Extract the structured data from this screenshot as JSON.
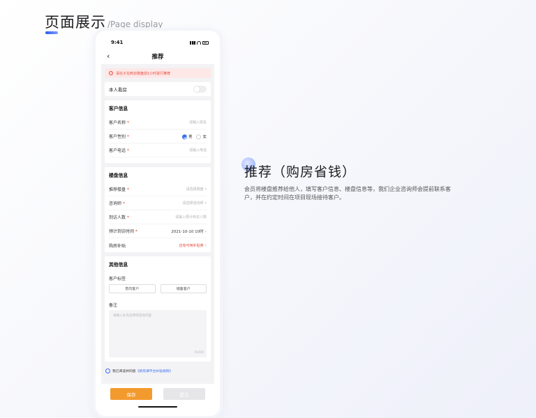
{
  "heading": {
    "zh": "页面展示",
    "en": "/Page display"
  },
  "status_bar": {
    "time": "9:41"
  },
  "nav": {
    "title": "推荐"
  },
  "notice": "请在子在到访楼盘前1小时进行推荐",
  "self_visit": {
    "label": "本人看房",
    "on": false
  },
  "customer": {
    "section": "客户信息",
    "name": {
      "label": "客户名称",
      "placeholder": "请输入姓名"
    },
    "gender": {
      "label": "客户性别",
      "male": "男",
      "female": "女",
      "selected": "男"
    },
    "phone": {
      "label": "客户电话",
      "placeholder": "请输入电话"
    }
  },
  "property": {
    "section": "楼盘信息",
    "recommend": {
      "label": "推荐楼盘",
      "value": "请选择楼盘"
    },
    "advisor": {
      "label": "咨询师",
      "value": "请选择咨询师"
    },
    "visitors": {
      "label": "到访人数",
      "value": "请输入预计到访人数"
    },
    "visit_time": {
      "label": "预计到访时间",
      "value": "2021-10-10  10时"
    },
    "subsidy": {
      "label": "购房补贴",
      "value": "应有可用补贴券"
    }
  },
  "other": {
    "section": "其他信息",
    "tags_label": "客户标签",
    "tags": [
      "意向客户",
      "储备客户"
    ],
    "note_label": "备注",
    "note_placeholder": "请输入补充说明或其他内容",
    "note_count": "0/200"
  },
  "agreement": {
    "text": "我已阅读并同意",
    "link": "《新房课平台补贴规则》"
  },
  "buttons": {
    "save": "保存",
    "submit": "提交"
  },
  "description": {
    "title": "推荐（购房省钱）",
    "body": "会员将楼盘推荐给他人，填写客户信息、楼盘信息等，我们企业咨询师会提前联系客户，并在约定时间在项目现场接待客户。"
  },
  "colors": {
    "accent_blue": "#3a6cf0",
    "save_orange": "#f39a2e",
    "warning_red": "#e64a3b"
  }
}
